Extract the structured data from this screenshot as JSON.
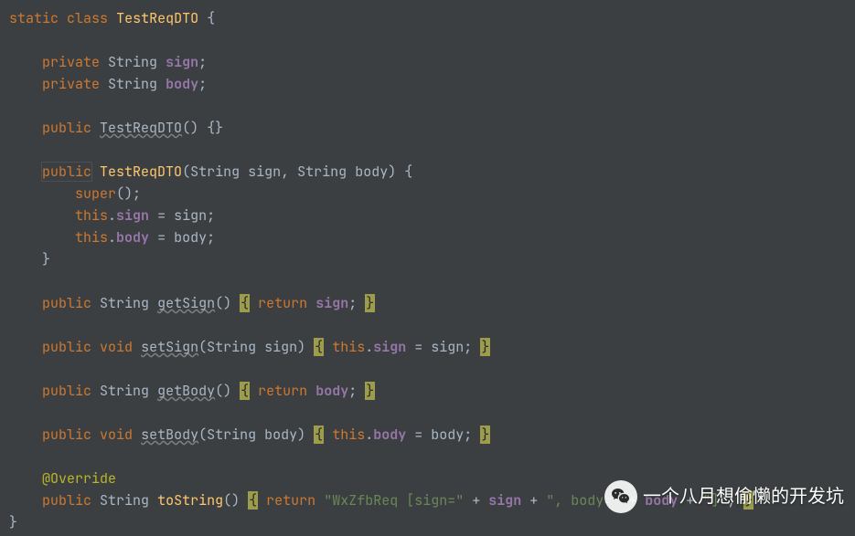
{
  "code": {
    "l1": {
      "static": "static",
      "class": "class",
      "name": "TestReqDTO",
      "brace": "{"
    },
    "l3_4": {
      "private": "private",
      "string": "String",
      "sign": "sign",
      "body": "body",
      "semi": ";"
    },
    "l6": {
      "public": "public",
      "ctor": "TestReqDTO",
      "parens": "()",
      "braces": "{}"
    },
    "l8": {
      "public": "public",
      "ctor": "TestReqDTO",
      "string": "String",
      "sign": "sign",
      "comma": ",",
      "body": "body",
      "brace": "{"
    },
    "l9": {
      "super": "super",
      "parens": "();"
    },
    "l10_11": {
      "this": "this",
      "dot": ".",
      "sign": "sign",
      "body": "body",
      "eq": " = ",
      "semi": ";"
    },
    "l12": {
      "brace": "}"
    },
    "getSign": {
      "public": "public",
      "string": "String",
      "name": "getSign",
      "parens": "()",
      "return": "return",
      "sign": "sign",
      "semi": ";"
    },
    "setSign": {
      "public": "public",
      "void": "void",
      "name": "setSign",
      "string": "String",
      "sign": "sign",
      "this": "this",
      "dot": ".",
      "eq": " = ",
      "semi": ";"
    },
    "getBody": {
      "public": "public",
      "string": "String",
      "name": "getBody",
      "parens": "()",
      "return": "return",
      "body": "body",
      "semi": ";"
    },
    "setBody": {
      "public": "public",
      "void": "void",
      "name": "setBody",
      "string": "String",
      "body": "body",
      "this": "this",
      "dot": ".",
      "eq": " = ",
      "semi": ";"
    },
    "override": "@Override",
    "toString": {
      "public": "public",
      "string": "String",
      "name": "toString",
      "parens": "()",
      "return": "return",
      "str1": "\"WxZfbReq [sign=\"",
      "plus": " + ",
      "sign": "sign",
      "str2": "\", body=\"",
      "body": "body",
      "str3": "\"]\"",
      "semi": ";"
    },
    "closeBrace": "}"
  },
  "watermark": {
    "text": "一个八月想偷懒的开发坑"
  }
}
